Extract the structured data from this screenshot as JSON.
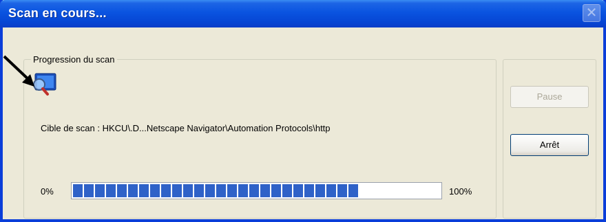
{
  "window": {
    "title": "Scan en cours...",
    "close_icon": "close-icon"
  },
  "scan": {
    "group_label": "Progression du scan",
    "target_text": "Cible de scan :  HKCU\\.D...Netscape Navigator\\Automation Protocols\\http",
    "progress_start": "0%",
    "progress_end": "100%",
    "progress_value": 0.78,
    "icon": "scan-monitor-magnifier-icon"
  },
  "buttons": {
    "pause_label": "Pause",
    "stop_label": "Arrêt"
  },
  "annotation": {
    "icon": "pointer-arrow-icon"
  },
  "colors": {
    "titlebar": "#0a54e0",
    "progress_fill": "#2f62c8",
    "window_bg": "#ece9d8"
  }
}
